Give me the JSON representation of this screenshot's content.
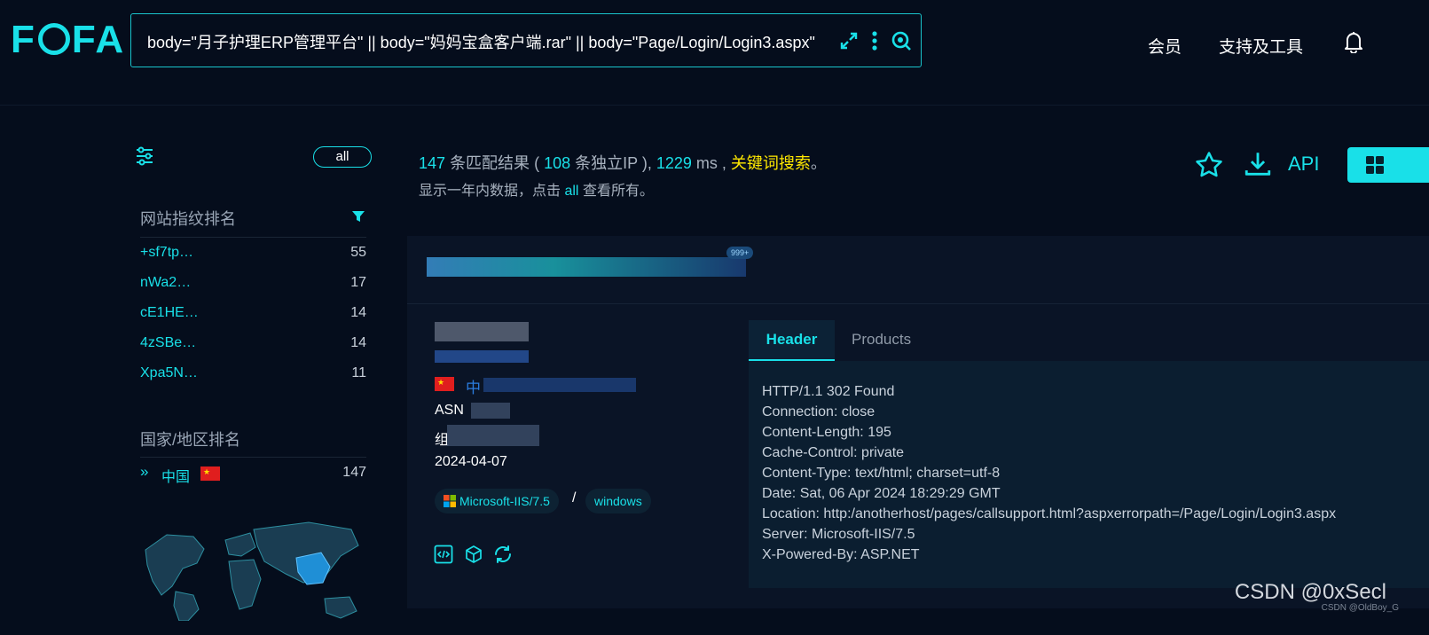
{
  "header": {
    "logo": {
      "left": "F",
      "right": "FA"
    },
    "search": {
      "query": "body=\"月子护理ERP管理平台\" || body=\"妈妈宝盒客户端.rar\" || body=\"Page/Login/Login3.aspx\""
    },
    "nav": {
      "member": "会员",
      "tools": "支持及工具"
    }
  },
  "sidebar": {
    "all_label": "all",
    "fingerprint_title": "网站指纹排名",
    "fingerprints": [
      {
        "name": "+sf7tp…",
        "count": "55"
      },
      {
        "name": "nWa2…",
        "count": "17"
      },
      {
        "name": "cE1HE…",
        "count": "14"
      },
      {
        "name": "4zSBe…",
        "count": "14"
      },
      {
        "name": "Xpa5N…",
        "count": "11"
      }
    ],
    "country_title": "国家/地区排名",
    "countries": [
      {
        "name": "中国",
        "count": "147"
      }
    ]
  },
  "stats": {
    "total": "147",
    "total_text": "条匹配结果 (",
    "unique_ip": "108",
    "unique_text": "条独立IP ),",
    "ms": "1229",
    "ms_unit": "ms ,",
    "keyword": "关键词搜索",
    "period": "。",
    "sub_prefix": "显示一年内数据，点击",
    "sub_all": "all",
    "sub_suffix": "查看所有。"
  },
  "toolbar": {
    "api": "API"
  },
  "result": {
    "badge": "999+",
    "asn_prefix": "ASN",
    "org_prefix": "组",
    "country_prefix": "中",
    "date": "2024-04-07",
    "server_tag": "Microsoft-IIS/7.5",
    "separator": "/",
    "os_tag": "windows",
    "tabs": {
      "header": "Header",
      "products": "Products"
    },
    "header_lines": [
      "HTTP/1.1 302 Found",
      "Connection: close",
      "Content-Length: 195",
      "Cache-Control: private",
      "Content-Type: text/html; charset=utf-8",
      "Date: Sat, 06 Apr 2024 18:29:29 GMT",
      "Location: http:/anotherhost/pages/callsupport.html?aspxerrorpath=/Page/Login/Login3.aspx",
      "Server: Microsoft-IIS/7.5",
      "X-Powered-By: ASP.NET"
    ]
  },
  "watermark": {
    "main": "CSDN @0xSecl",
    "small": "CSDN @OldBoy_G"
  },
  "colors": {
    "accent": "#19e0e8",
    "background": "#050d1c",
    "keyword": "#ffe800",
    "card": "#0a1426"
  }
}
